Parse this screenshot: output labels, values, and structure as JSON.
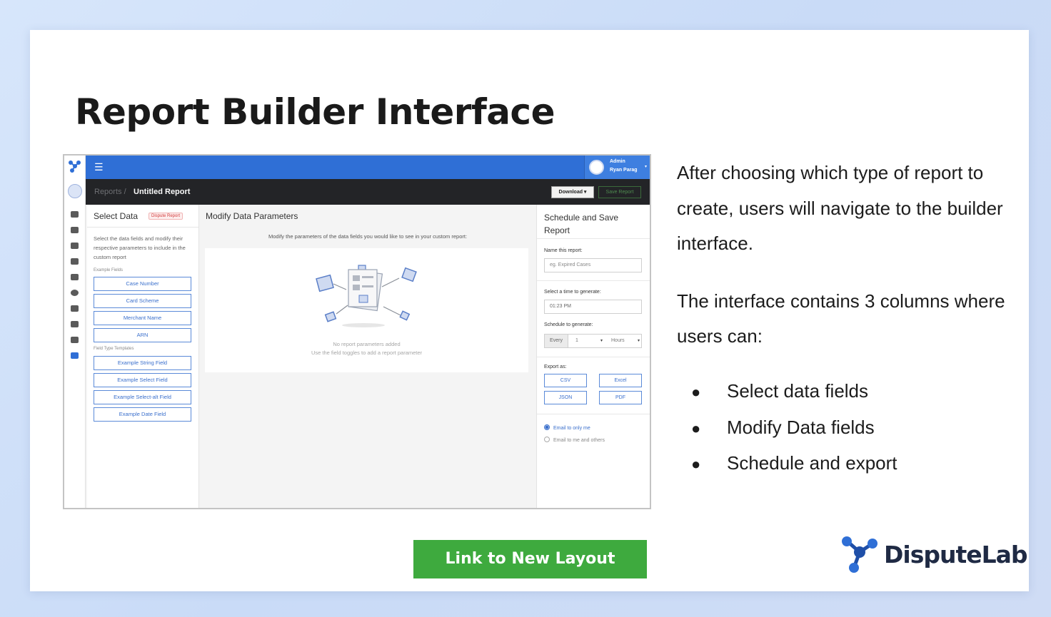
{
  "slide": {
    "title": "Report Builder Interface",
    "link_button": "Link to New Layout",
    "brand_name": "DisputeLab",
    "accent_green": "#3eaa3e",
    "brand_blue": "#2f6fd6"
  },
  "side_text": {
    "paragraph1": "After choosing which type of report to create, users will navigate to the builder interface.",
    "paragraph2": "The interface contains 3 columns where users can:",
    "bullet_glyph": "●",
    "bullets": [
      "Select data fields",
      "Modify Data fields",
      "Schedule and export"
    ]
  },
  "screenshot": {
    "topbar": {
      "menu_icon": "☰",
      "admin_line1": "Admin",
      "admin_line2": "Ryan Parag",
      "caret": "▾"
    },
    "breadcrumb": {
      "parent": "Reports /",
      "current": "Untitled Report",
      "download_button": "Download ▾",
      "save_button": "Save Report"
    },
    "left_column": {
      "heading": "Select Data",
      "badge": "Dispute Report",
      "description": "Select the data fields and modify their respective parameters to include in the custom report",
      "example_fields_label": "Example Fields",
      "example_fields": [
        "Case Number",
        "Card Scheme",
        "Merchant Name",
        "ARN"
      ],
      "templates_label": "Field Type Templates",
      "templates": [
        "Example String Field",
        "Example Select Field",
        "Example Select-alt Field",
        "Example Date Field"
      ]
    },
    "middle_column": {
      "heading": "Modify Data Parameters",
      "hint": "Modify the parameters of the data fields you would like to see in your custom report:",
      "empty_title": "No report parameters added",
      "empty_subtitle": "Use the field toggles to add a report parameter"
    },
    "right_column": {
      "heading": "Schedule and Save Report",
      "name_label": "Name this report:",
      "name_placeholder": "eg. Expired Cases",
      "time_label": "Select a time to generate:",
      "time_value": "01:23 PM",
      "schedule_label": "Schedule to generate:",
      "every_label": "Every",
      "every_value": "1",
      "unit_value": "Hours",
      "export_label": "Export as:",
      "export_buttons": [
        "CSV",
        "Excel",
        "JSON",
        "PDF"
      ],
      "email_options": [
        "Email to only me",
        "Email to me and others"
      ],
      "email_selected": "Email to only me"
    }
  }
}
